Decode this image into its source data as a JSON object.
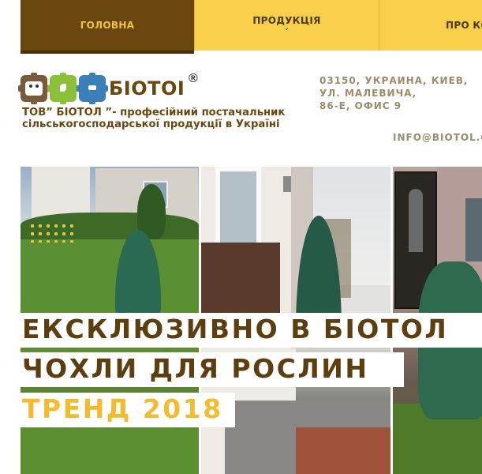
{
  "nav": {
    "items": [
      {
        "label": "ГОЛОВНА",
        "active": true
      },
      {
        "label": "ПРОДУКЦІЯ",
        "has_dropdown": true
      },
      {
        "label": "ПРО КО"
      }
    ],
    "chevron": "˅"
  },
  "logo": {
    "icons": [
      "gear-face-brown",
      "gear-face-green",
      "gear-face-blue"
    ],
    "brand": "БIOTOI",
    "registered": "®"
  },
  "tagline": {
    "line1": "ТОВ” БІОТОЛ ”- професійний постачальник",
    "line2": "сільськогосподарської продукції в Україні"
  },
  "contact": {
    "address_lines": [
      "03150, УКРАИНА, КИЕВ,",
      "УЛ. МАЛЕВИЧА,",
      "86-Е, ОФИС 9"
    ],
    "email": "INFO@BIOTOL.C"
  },
  "hero": {
    "headline1": "ЕКСКЛЮЗИВНО В БІОТОЛ",
    "headline2": "ЧОХЛИ ДЛЯ РОСЛИН",
    "headline3": "ТРЕНД 2018"
  },
  "colors": {
    "nav_active": "#6b4710",
    "nav_bg": "#f7cf4a",
    "brand_brown": "#6b4710",
    "accent_yellow": "#f2bc2e",
    "muted_text": "#9d8a6a"
  }
}
